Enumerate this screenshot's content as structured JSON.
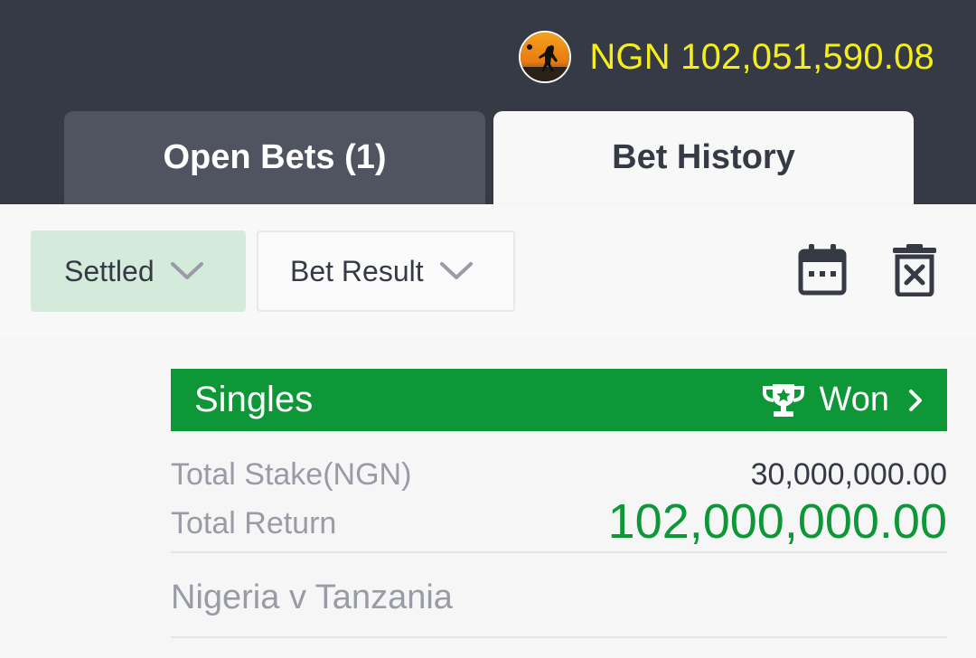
{
  "header": {
    "balance": "NGN 102,051,590.08",
    "balance_color": "#f5ee1b"
  },
  "tabs": [
    {
      "label": "Open Bets (1)",
      "active": false
    },
    {
      "label": "Bet History",
      "active": true
    }
  ],
  "filters": {
    "status": "Settled",
    "result": "Bet Result",
    "icons": [
      "calendar-icon",
      "delete-icon"
    ]
  },
  "bet": {
    "type": "Singles",
    "result": "Won",
    "stake_label": "Total Stake(NGN)",
    "stake_value": "30,000,000.00",
    "return_label": "Total Return",
    "return_value": "102,000,000.00",
    "match": "Nigeria v Tanzania",
    "accent_color": "#0d9737"
  }
}
